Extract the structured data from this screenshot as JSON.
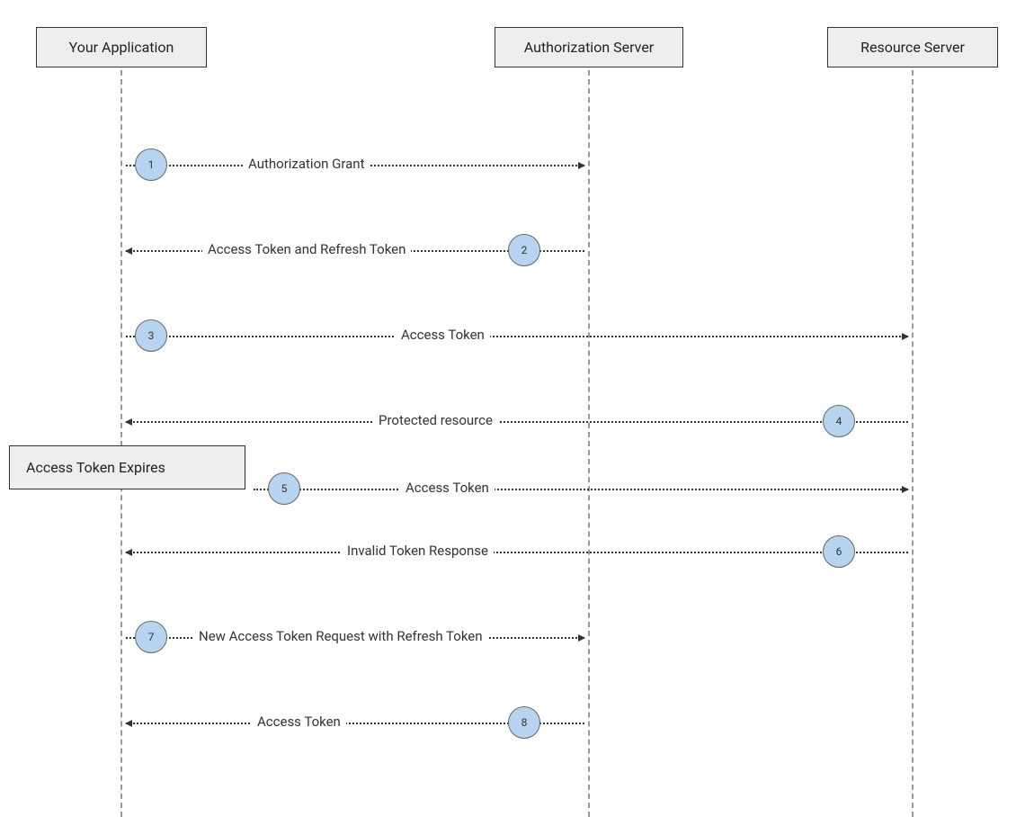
{
  "participants": {
    "app": "Your Application",
    "auth": "Authorization Server",
    "resource": "Resource Server"
  },
  "note": "Access Token Expires",
  "steps": {
    "s1": {
      "num": "1",
      "label": "Authorization Grant"
    },
    "s2": {
      "num": "2",
      "label": "Access Token and Refresh Token"
    },
    "s3": {
      "num": "3",
      "label": "Access Token"
    },
    "s4": {
      "num": "4",
      "label": "Protected resource"
    },
    "s5": {
      "num": "5",
      "label": "Access Token"
    },
    "s6": {
      "num": "6",
      "label": "Invalid Token Response"
    },
    "s7": {
      "num": "7",
      "label": "New Access Token Request with Refresh Token"
    },
    "s8": {
      "num": "8",
      "label": "Access Token"
    }
  }
}
